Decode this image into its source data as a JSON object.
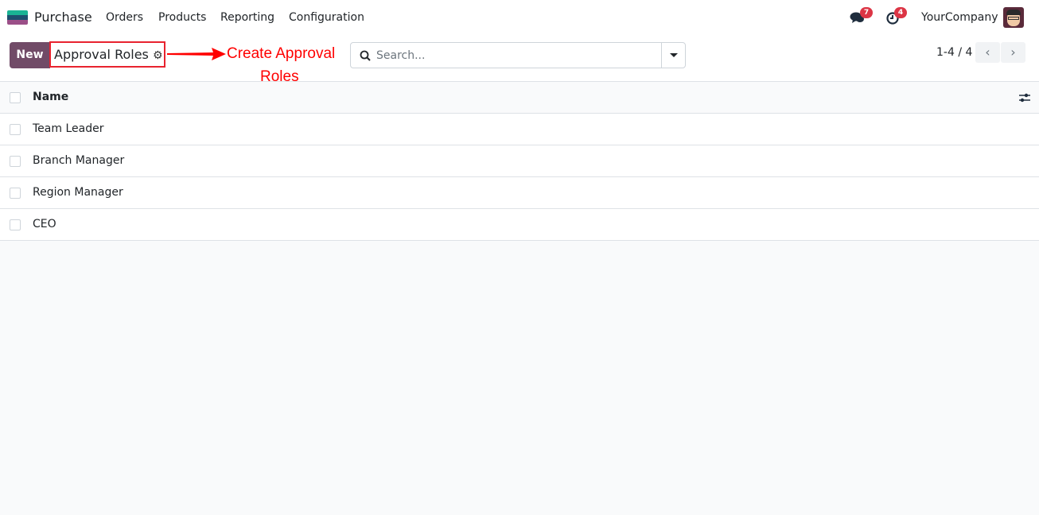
{
  "topbar": {
    "app_name": "Purchase",
    "menu": [
      "Orders",
      "Products",
      "Reporting",
      "Configuration"
    ],
    "messages_count": "7",
    "activities_count": "4",
    "company": "YourCompany"
  },
  "control": {
    "new_label": "New",
    "breadcrumb": "Approval Roles",
    "annotation": [
      "Create Approval",
      "Roles"
    ],
    "search_placeholder": "Search...",
    "pager": "1-4 / 4"
  },
  "list": {
    "header": "Name",
    "rows": [
      "Team Leader",
      "Branch Manager",
      "Region Manager",
      "CEO"
    ]
  },
  "colors": {
    "brand": "#714b67",
    "annotation": "#ff0000",
    "badge": "#dc3545"
  }
}
